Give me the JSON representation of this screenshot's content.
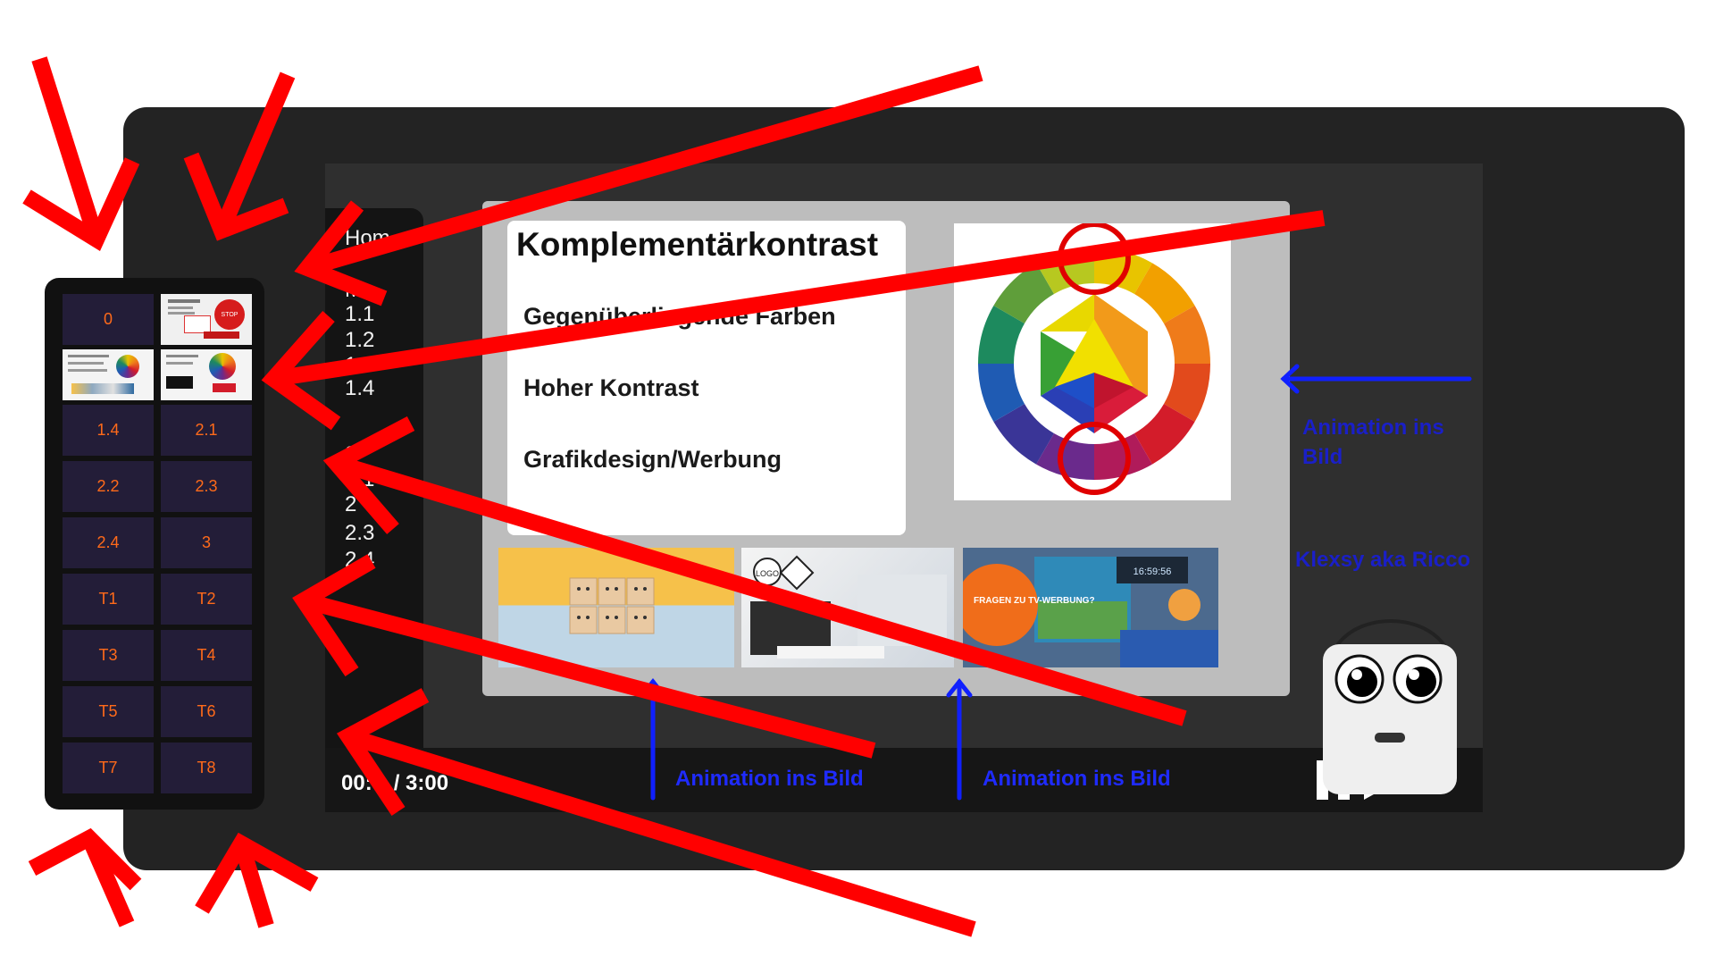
{
  "video": {
    "time_display": "00:",
    "time_separator": "/ 3:00",
    "outline_items": [
      "Hom",
      "M",
      "1.1",
      "1.2",
      "1.3",
      "1.4",
      "2",
      "2.1",
      "2",
      "2.3",
      "2.4"
    ],
    "slide": {
      "title": "Komplementärkontrast",
      "bullets": [
        "Gegenüberliegende Farben",
        "Hoher Kontrast",
        "Grafikdesign/Werbung"
      ],
      "thumb_badge": "FRAGEN ZU TV-WERBUNG?",
      "clock_text": "16:59:56",
      "logo_text": "LOGO"
    },
    "player_icons": [
      "pause-icon",
      "play-icon"
    ]
  },
  "chapters": {
    "items": [
      {
        "label": "0",
        "type": "text"
      },
      {
        "label": "",
        "type": "thumb"
      },
      {
        "label": "",
        "type": "thumb"
      },
      {
        "label": "",
        "type": "thumb"
      },
      {
        "label": "1.4",
        "type": "text"
      },
      {
        "label": "2.1",
        "type": "text"
      },
      {
        "label": "2.2",
        "type": "text"
      },
      {
        "label": "2.3",
        "type": "text"
      },
      {
        "label": "2.4",
        "type": "text"
      },
      {
        "label": "3",
        "type": "text"
      },
      {
        "label": "T1",
        "type": "text"
      },
      {
        "label": "T2",
        "type": "text"
      },
      {
        "label": "T3",
        "type": "text"
      },
      {
        "label": "T4",
        "type": "text"
      },
      {
        "label": "T5",
        "type": "text"
      },
      {
        "label": "T6",
        "type": "text"
      },
      {
        "label": "T7",
        "type": "text"
      },
      {
        "label": "T8",
        "type": "text"
      }
    ],
    "thumb_stop_text": "STOP"
  },
  "annotations": {
    "right_arrow_label_1": "Animation ins",
    "right_arrow_label_2": "Bild",
    "mascot_label": "Klexsy aka Ricco",
    "bottom_label_1": "Animation ins Bild",
    "bottom_label_2": "Animation ins Bild"
  },
  "colors": {
    "chapter_text": "#ff6a1a",
    "chapter_bg": "#231d38",
    "annotation_blue": "#1f2bff",
    "annotation_red": "#ff0000",
    "device_bg": "#232323"
  }
}
